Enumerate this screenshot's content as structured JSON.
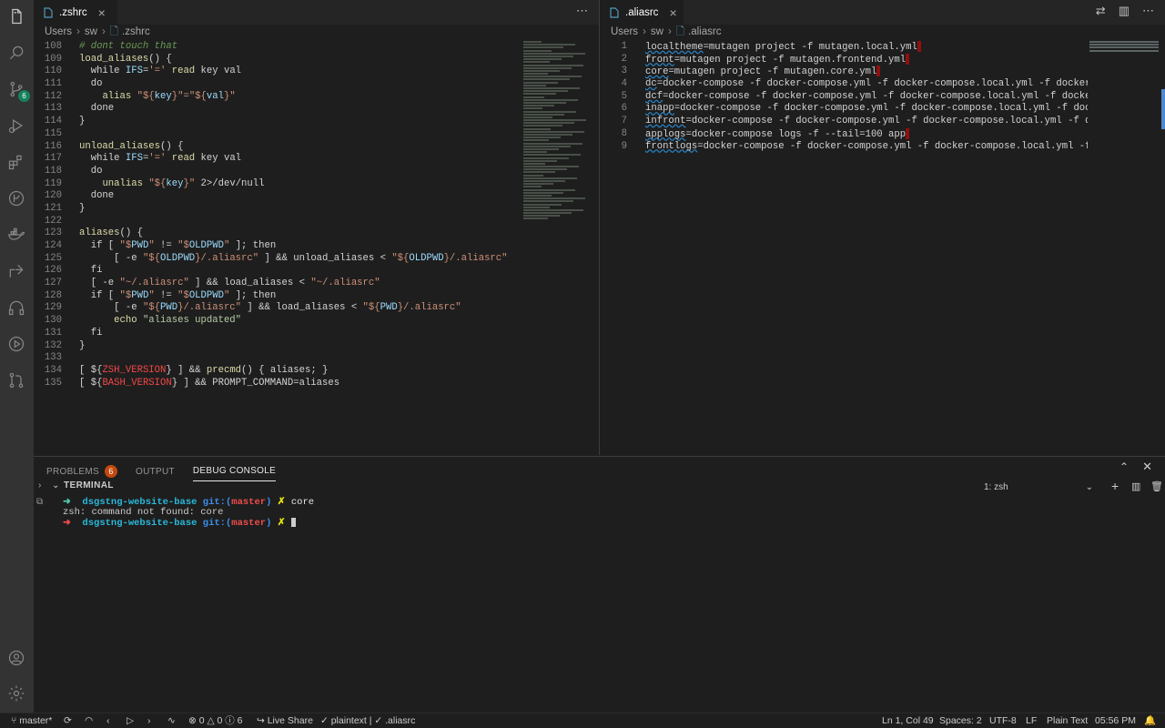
{
  "left_editor": {
    "tab_label": ".zshrc",
    "breadcrumb": [
      "Users",
      "sw",
      ".zshrc"
    ],
    "lines": [
      {
        "n": "108",
        "code": [
          [
            "c-cm",
            "# dont touch that"
          ]
        ]
      },
      {
        "n": "109",
        "code": [
          [
            "c-fn",
            "load_aliases"
          ],
          [
            "c-pl",
            "() {"
          ]
        ]
      },
      {
        "n": "110",
        "code": [
          [
            "c-pl",
            "  while "
          ],
          [
            "c-var",
            "IFS"
          ],
          [
            "c-pl",
            "="
          ],
          [
            "c-str",
            "'='"
          ],
          [
            "c-pl",
            " "
          ],
          [
            "c-fn",
            "read"
          ],
          [
            "c-pl",
            " key val"
          ]
        ]
      },
      {
        "n": "111",
        "code": [
          [
            "c-pl",
            "  do"
          ]
        ]
      },
      {
        "n": "112",
        "code": [
          [
            "c-pl",
            "    "
          ],
          [
            "c-fn",
            "alias"
          ],
          [
            "c-pl",
            " "
          ],
          [
            "c-str",
            "\"${"
          ],
          [
            "c-var",
            "key"
          ],
          [
            "c-str",
            "}\"=\"${"
          ],
          [
            "c-var",
            "val"
          ],
          [
            "c-str",
            "}\""
          ]
        ]
      },
      {
        "n": "113",
        "code": [
          [
            "c-pl",
            "  done"
          ]
        ]
      },
      {
        "n": "114",
        "code": [
          [
            "c-pl",
            "}"
          ]
        ]
      },
      {
        "n": "115",
        "code": [
          [
            "c-pl",
            ""
          ]
        ]
      },
      {
        "n": "116",
        "code": [
          [
            "c-fn",
            "unload_aliases"
          ],
          [
            "c-pl",
            "() {"
          ]
        ]
      },
      {
        "n": "117",
        "code": [
          [
            "c-pl",
            "  while "
          ],
          [
            "c-var",
            "IFS"
          ],
          [
            "c-pl",
            "="
          ],
          [
            "c-str",
            "'='"
          ],
          [
            "c-pl",
            " "
          ],
          [
            "c-fn",
            "read"
          ],
          [
            "c-pl",
            " key val"
          ]
        ]
      },
      {
        "n": "118",
        "code": [
          [
            "c-pl",
            "  do"
          ]
        ]
      },
      {
        "n": "119",
        "code": [
          [
            "c-pl",
            "    "
          ],
          [
            "c-fn",
            "unalias"
          ],
          [
            "c-pl",
            " "
          ],
          [
            "c-str",
            "\"${"
          ],
          [
            "c-var",
            "key"
          ],
          [
            "c-str",
            "}\""
          ],
          [
            "c-pl",
            " 2>/dev/null"
          ]
        ]
      },
      {
        "n": "120",
        "code": [
          [
            "c-pl",
            "  done"
          ]
        ]
      },
      {
        "n": "121",
        "code": [
          [
            "c-pl",
            "}"
          ]
        ]
      },
      {
        "n": "122",
        "code": [
          [
            "c-pl",
            ""
          ]
        ]
      },
      {
        "n": "123",
        "code": [
          [
            "c-fn",
            "aliases"
          ],
          [
            "c-pl",
            "() {"
          ]
        ]
      },
      {
        "n": "124",
        "code": [
          [
            "c-pl",
            "  if [ "
          ],
          [
            "c-str",
            "\"$"
          ],
          [
            "c-var",
            "PWD"
          ],
          [
            "c-str",
            "\""
          ],
          [
            "c-pl",
            " != "
          ],
          [
            "c-str",
            "\"$"
          ],
          [
            "c-var",
            "OLDPWD"
          ],
          [
            "c-str",
            "\""
          ],
          [
            "c-pl",
            " ]; then"
          ]
        ]
      },
      {
        "n": "125",
        "code": [
          [
            "c-pl",
            "      [ -e "
          ],
          [
            "c-str",
            "\"${"
          ],
          [
            "c-var",
            "OLDPWD"
          ],
          [
            "c-str",
            "}/.aliasrc\""
          ],
          [
            "c-pl",
            " ] && unload_aliases < "
          ],
          [
            "c-str",
            "\"${"
          ],
          [
            "c-var",
            "OLDPWD"
          ],
          [
            "c-str",
            "}/.aliasrc\""
          ]
        ]
      },
      {
        "n": "126",
        "code": [
          [
            "c-pl",
            "  fi"
          ]
        ]
      },
      {
        "n": "127",
        "code": [
          [
            "c-pl",
            "  [ -e "
          ],
          [
            "c-str",
            "\"~/.aliasrc\""
          ],
          [
            "c-pl",
            " ] && load_aliases < "
          ],
          [
            "c-str",
            "\"~/.aliasrc\""
          ]
        ]
      },
      {
        "n": "128",
        "code": [
          [
            "c-pl",
            "  if [ "
          ],
          [
            "c-str",
            "\"$"
          ],
          [
            "c-var",
            "PWD"
          ],
          [
            "c-str",
            "\""
          ],
          [
            "c-pl",
            " != "
          ],
          [
            "c-str",
            "\"$"
          ],
          [
            "c-var",
            "OLDPWD"
          ],
          [
            "c-str",
            "\""
          ],
          [
            "c-pl",
            " ]; then"
          ]
        ]
      },
      {
        "n": "129",
        "code": [
          [
            "c-pl",
            "      [ -e "
          ],
          [
            "c-str",
            "\"${"
          ],
          [
            "c-var",
            "PWD"
          ],
          [
            "c-str",
            "}/.aliasrc\""
          ],
          [
            "c-pl",
            " ] && load_aliases < "
          ],
          [
            "c-str",
            "\"${"
          ],
          [
            "c-var",
            "PWD"
          ],
          [
            "c-str",
            "}/.aliasrc\""
          ]
        ]
      },
      {
        "n": "130",
        "code": [
          [
            "c-pl",
            "      "
          ],
          [
            "c-fn",
            "echo"
          ],
          [
            "c-pl",
            " "
          ],
          [
            "c-grn",
            "\"aliases updated\""
          ]
        ]
      },
      {
        "n": "131",
        "code": [
          [
            "c-pl",
            "  fi"
          ]
        ]
      },
      {
        "n": "132",
        "code": [
          [
            "c-pl",
            "}"
          ]
        ]
      },
      {
        "n": "133",
        "code": [
          [
            "c-pl",
            ""
          ]
        ]
      },
      {
        "n": "134",
        "code": [
          [
            "c-pl",
            "[ ${"
          ],
          [
            "c-red",
            "ZSH_VERSION"
          ],
          [
            "c-pl",
            "} ] && "
          ],
          [
            "c-fn",
            "precmd"
          ],
          [
            "c-pl",
            "() { aliases; }"
          ]
        ]
      },
      {
        "n": "135",
        "code": [
          [
            "c-pl",
            "[ ${"
          ],
          [
            "c-red",
            "BASH_VERSION"
          ],
          [
            "c-pl",
            "} ] && PROMPT_COMMAND=aliases"
          ]
        ]
      }
    ]
  },
  "right_editor": {
    "tab_label": ".aliasrc",
    "breadcrumb": [
      "Users",
      "sw",
      ".aliasrc"
    ],
    "lines": [
      {
        "n": "1",
        "name": "localtheme",
        "rest": "=mutagen project -f mutagen.local.yml",
        "cursor": true
      },
      {
        "n": "2",
        "name": "front",
        "rest": "=mutagen project -f mutagen.frontend.yml",
        "cursor": true
      },
      {
        "n": "3",
        "name": "core",
        "rest": "=mutagen project -f mutagen.core.yml",
        "cursor": true
      },
      {
        "n": "4",
        "name": "dc",
        "rest": "=docker-compose -f docker-compose.yml -f docker-compose.local.yml -f docker-compose.ss",
        "cursor": false
      },
      {
        "n": "5",
        "name": "dcf",
        "rest": "=docker-compose -f docker-compose.yml -f docker-compose.local.yml -f docker-compose.s",
        "cursor": false
      },
      {
        "n": "6",
        "name": "inapp",
        "rest": "=docker-compose -f docker-compose.yml -f docker-compose.local.yml -f docker-compose.",
        "cursor": false
      },
      {
        "n": "7",
        "name": "infront",
        "rest": "=docker-compose -f docker-compose.yml -f docker-compose.local.yml -f docker-compos",
        "cursor": false
      },
      {
        "n": "8",
        "name": "applogs",
        "rest": "=docker-compose logs -f --tail=100 app",
        "cursor": true
      },
      {
        "n": "9",
        "name": "frontlogs",
        "rest": "=docker-compose -f docker-compose.yml -f docker-compose.local.yml -f docker-comp",
        "cursor": false
      }
    ]
  },
  "panel": {
    "tabs": [
      {
        "label": "PROBLEMS",
        "badge": "6",
        "active": false
      },
      {
        "label": "OUTPUT",
        "badge": "",
        "active": false
      },
      {
        "label": "DEBUG CONSOLE",
        "badge": "",
        "active": true
      }
    ],
    "terminal_title": "TERMINAL",
    "terminal_select": "1: zsh",
    "terminal_lines": [
      {
        "arrow": "➜",
        "arrow_color": "#4ec9b0",
        "dir": "dsgstng-website-base",
        "git": "git:(",
        "branch": "master",
        "git_end": ")",
        "x": "✗",
        "cmd": "core"
      },
      {
        "plain": "zsh: command not found: core"
      },
      {
        "arrow": "➜",
        "arrow_color": "#f14c4c",
        "dir": "dsgstng-website-base",
        "git": "git:(",
        "branch": "master",
        "git_end": ")",
        "x": "✗",
        "cmd": ""
      }
    ]
  },
  "statusbar": {
    "branch": "master*",
    "errors": "0",
    "warnings": "0",
    "infos": "6",
    "live_share": "Live Share",
    "lint": "plaintext | ✓ .aliasrc",
    "position": "Ln 1, Col 49",
    "spaces": "Spaces: 2",
    "encoding": "UTF-8",
    "eol": "LF",
    "language": "Plain Text",
    "time": "05:56 PM"
  },
  "scm_badge": "6",
  "colors": {
    "accent": "#007acc",
    "badge": "#c4490f",
    "scm_badge": "#16825d"
  }
}
